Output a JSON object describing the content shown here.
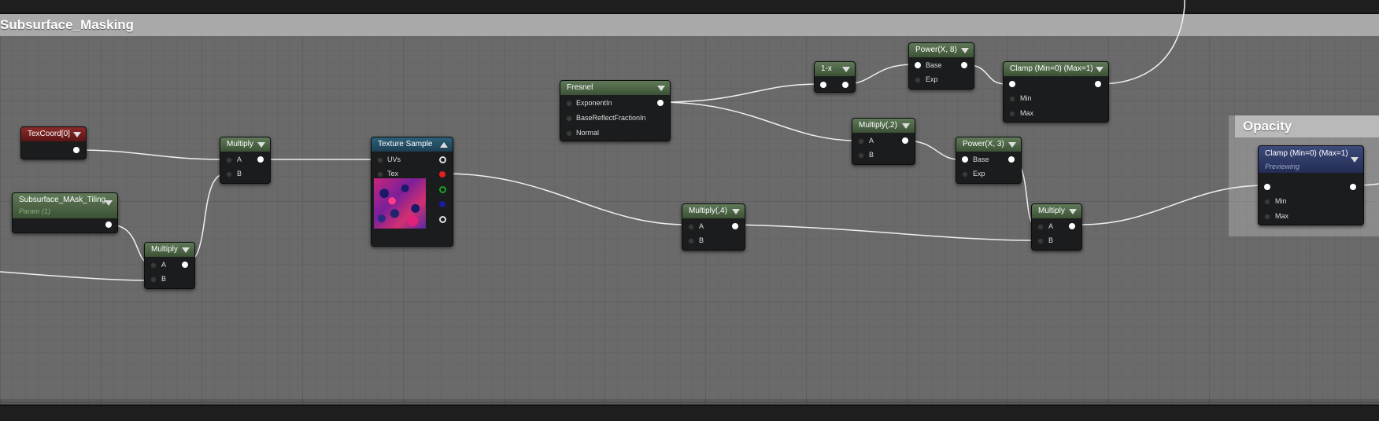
{
  "comment_title": "Subsurface_Masking",
  "opacity_comment_title": "Opacity",
  "colors": {
    "wire": "#f0f0f0",
    "background": "#5b5b5b",
    "constant_header": "#3c5135",
    "texcoord_header": "#5a1414",
    "texture_header": "#1c3f52",
    "clamp_preview_header": "#232d55"
  },
  "nodes": {
    "texcoord": {
      "title": "TexCoord[0]"
    },
    "tiling_param": {
      "title": "Subsurface_MAsk_Tiling",
      "subtitle": "Param (1)"
    },
    "multiply_top": {
      "title": "Multiply",
      "a": "A",
      "b": "B"
    },
    "multiply_bottom": {
      "title": "Multiply",
      "a": "A",
      "b": "B"
    },
    "texture_sample": {
      "title": "Texture Sample",
      "uvs": "UVs",
      "tex": "Tex"
    },
    "fresnel": {
      "title": "Fresnel",
      "exponent_in": "ExponentIn",
      "base_reflect": "BaseReflectFractionIn",
      "normal": "Normal"
    },
    "one_minus": {
      "title": "1-x"
    },
    "power_8": {
      "title": "Power(X, 8)",
      "base": "Base",
      "exp": "Exp"
    },
    "clamp_top": {
      "title": "Clamp (Min=0) (Max=1)",
      "min": "Min",
      "max": "Max"
    },
    "multiply_2": {
      "title": "Multiply(,2)",
      "a": "A",
      "b": "B"
    },
    "power_3": {
      "title": "Power(X, 3)",
      "base": "Base",
      "exp": "Exp"
    },
    "multiply_4": {
      "title": "Multiply(,4)",
      "a": "A",
      "b": "B"
    },
    "multiply_right": {
      "title": "Multiply",
      "a": "A",
      "b": "B"
    },
    "clamp_preview": {
      "title": "Clamp (Min=0) (Max=1)",
      "subtitle": "Previewing",
      "min": "Min",
      "max": "Max"
    }
  }
}
